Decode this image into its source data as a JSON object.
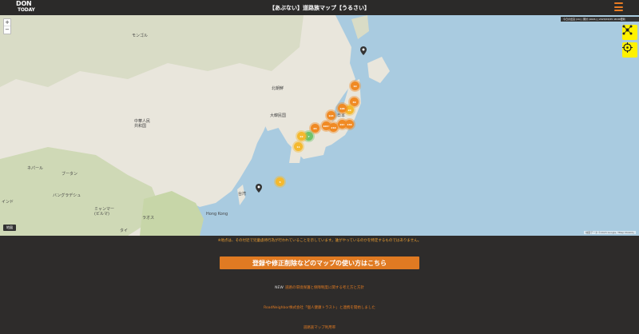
{
  "header": {
    "logo_top": "DON",
    "logo_bottom": "TODAY",
    "title": "【あぶない】道路族マップ【うるさい】"
  },
  "map": {
    "zoom_in": "+",
    "zoom_out": "−",
    "info": "今日の出没 (11) | 累計 (4021) | 2023/03/05 18:00更新",
    "labels": {
      "mongolia": "モンゴル",
      "china": "中華人民\n共和国",
      "north_korea": "北朝鮮",
      "south_korea": "大韓民国",
      "japan": "日本",
      "taiwan": "台湾",
      "india": "インド",
      "bangladesh": "バングラデシュ",
      "myanmar": "ミャンマー\n(ビルマ)",
      "thailand": "タイ",
      "laos": "ラオス",
      "hong_kong": "Hong Kong",
      "bhutan": "ブータン",
      "nepal": "ネパール"
    },
    "clusters": [
      {
        "label": "10",
        "kind": "o"
      },
      {
        "label": "30",
        "kind": "o"
      },
      {
        "label": "20",
        "kind": "y"
      },
      {
        "label": "106",
        "kind": "o"
      },
      {
        "label": "203",
        "kind": "o"
      },
      {
        "label": "156",
        "kind": "o"
      },
      {
        "label": "103",
        "kind": "o"
      },
      {
        "label": "1004",
        "kind": "o"
      },
      {
        "label": "210",
        "kind": "o"
      },
      {
        "label": "65",
        "kind": "o"
      },
      {
        "label": "7",
        "kind": "g"
      },
      {
        "label": "22",
        "kind": "y"
      },
      {
        "label": "11",
        "kind": "y"
      },
      {
        "label": "5",
        "kind": "y"
      }
    ],
    "type_button": "地図",
    "attribution": "地図データ ©2023 Google, TMap Mobility"
  },
  "footer": {
    "notice": "※地点は、その付近で児童虐待行為が行われていることを示しています。誰がやっているのかを特定するものではありません。",
    "howto_button": "登録や修正削除などのマップの使い方はこちら",
    "new_badge": "NEW",
    "new_link": "道路の環境保護と保障制度に関する考え方と方針",
    "link2": "RoadNeighbor株式会社「個人健康トラスト」と連携を開始しました",
    "link3": "道路族マップ利用率"
  },
  "colors": {
    "accent": "#e07a22",
    "cluster_orange": "#f08a24",
    "cluster_yellow": "#f5b92e",
    "cluster_green": "#6fc36a",
    "tool_yellow": "#fff200"
  }
}
